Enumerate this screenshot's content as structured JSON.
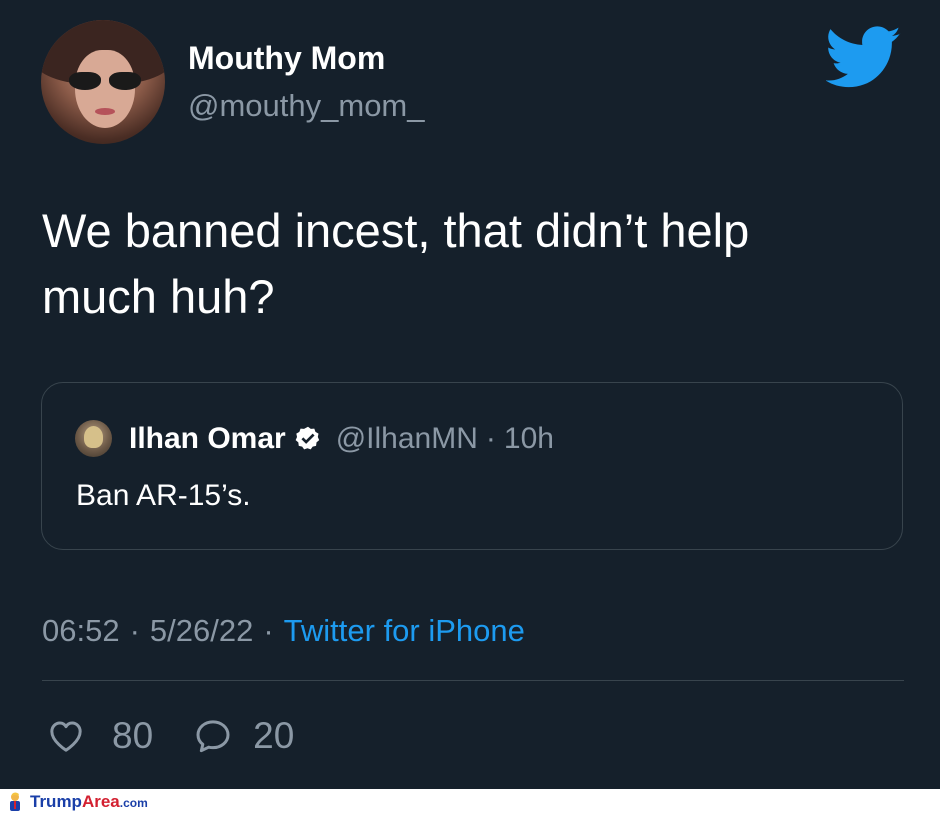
{
  "tweet": {
    "author": {
      "display_name": "Mouthy Mom",
      "handle": "@mouthy_mom_",
      "avatar_icon": "profile-photo"
    },
    "brand_icon": "twitter-bird-icon",
    "text_line1": "We banned incest, that didn’t help",
    "text_line2": "much huh?",
    "quoted": {
      "display_name": "Ilhan Omar",
      "verified_icon": "verified-badge-icon",
      "handle": "@IlhanMN",
      "separator": "·",
      "time": "10h",
      "text": "Ban AR-15’s."
    },
    "meta": {
      "time": "06:52",
      "separator1": "·",
      "date": "5/26/22",
      "separator2": "·",
      "source": "Twitter for iPhone"
    },
    "actions": {
      "likes_icon": "heart-icon",
      "likes": "80",
      "replies_icon": "reply-bubble-icon",
      "replies": "20"
    }
  },
  "footer": {
    "brand_part1": "Trump",
    "brand_part2": "Area",
    "brand_suffix": ".com"
  },
  "colors": {
    "background": "#15202b",
    "text_primary": "#ffffff",
    "text_muted": "#8b98a5",
    "accent": "#1d9bf0",
    "border": "#38444d"
  }
}
